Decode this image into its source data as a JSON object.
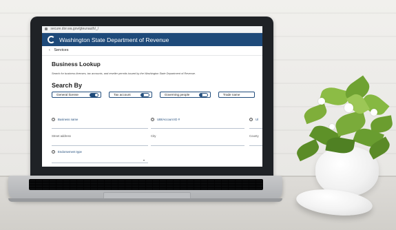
{
  "browser": {
    "url": "secure.dor.wa.gov/gteunauth/_/"
  },
  "header": {
    "title": "Washington State Department of Revenue"
  },
  "nav": {
    "back_label": "Services"
  },
  "page": {
    "title": "Business Lookup",
    "description": "Search for business licenses, tax accounts, and reseller permits issued by the Washington State Department of Revenue."
  },
  "search_by": {
    "title": "Search By",
    "options": [
      {
        "label": "General license",
        "state": "on"
      },
      {
        "label": "Tax account",
        "state": "off"
      },
      {
        "label": "Governing people",
        "state": "off"
      },
      {
        "label": "Trade name",
        "state": "off"
      }
    ]
  },
  "fields": {
    "business_name": "Business name",
    "ubi_account": "UBI/Account ID #",
    "ubi_partial": "Ul",
    "street_address": "Street address",
    "city": "City",
    "county": "County",
    "endorsement_type": "Endorsement type"
  },
  "colors": {
    "brand": "#1e4a7a",
    "header_bg": "#1e4a7a"
  }
}
